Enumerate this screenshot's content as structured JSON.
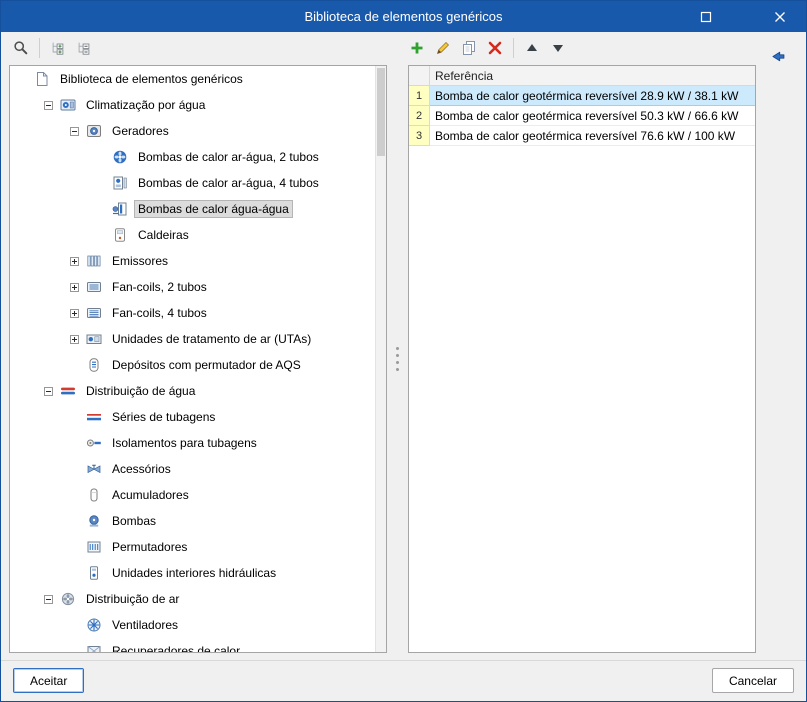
{
  "window": {
    "title": "Biblioteca de elementos genéricos",
    "buttons": [
      {
        "name": "maximize",
        "icon": "maximize"
      },
      {
        "name": "close",
        "icon": "close"
      }
    ]
  },
  "toolbar": {
    "left_buttons": [
      {
        "name": "search",
        "icon": "search"
      },
      {
        "name": "separator"
      },
      {
        "name": "expand-all",
        "icon": "tree-expand"
      },
      {
        "name": "collapse-all",
        "icon": "tree-collapse"
      }
    ],
    "right_buttons": [
      {
        "name": "add",
        "icon": "plus"
      },
      {
        "name": "edit",
        "icon": "pencil"
      },
      {
        "name": "copy",
        "icon": "copy"
      },
      {
        "name": "delete",
        "icon": "cross"
      },
      {
        "name": "separator"
      },
      {
        "name": "move-up",
        "icon": "arrow-up"
      },
      {
        "name": "move-down",
        "icon": "arrow-down"
      }
    ],
    "nav_button": {
      "name": "back",
      "icon": "back-arrow"
    }
  },
  "tree": {
    "items": [
      {
        "label": "Biblioteca de elementos genéricos",
        "level": 0,
        "icon": "library-document",
        "expander": "none",
        "selected": false
      },
      {
        "label": "Climatização por água",
        "level": 1,
        "icon": "water-climate-unit",
        "expander": "minus",
        "selected": false
      },
      {
        "label": "Geradores",
        "level": 2,
        "icon": "generator-unit",
        "expander": "minus",
        "selected": false
      },
      {
        "label": "Bombas de calor ar-água, 2 tubos",
        "level": 3,
        "icon": "heat-pump-fan",
        "expander": "none",
        "selected": false
      },
      {
        "label": "Bombas de calor ar-água, 4 tubos",
        "level": 3,
        "icon": "heat-pump-unit",
        "expander": "none",
        "selected": false
      },
      {
        "label": "Bombas de calor água-água",
        "level": 3,
        "icon": "water-water-pump",
        "expander": "none",
        "selected": true
      },
      {
        "label": "Caldeiras",
        "level": 3,
        "icon": "boiler",
        "expander": "none",
        "selected": false
      },
      {
        "label": "Emissores",
        "level": 2,
        "icon": "radiator",
        "expander": "plus",
        "selected": false
      },
      {
        "label": "Fan-coils, 2 tubos",
        "level": 2,
        "icon": "fancoil-2",
        "expander": "plus",
        "selected": false
      },
      {
        "label": "Fan-coils, 4 tubos",
        "level": 2,
        "icon": "fancoil-4",
        "expander": "plus",
        "selected": false
      },
      {
        "label": "Unidades de tratamento de ar (UTAs)",
        "level": 2,
        "icon": "ahu",
        "expander": "plus",
        "selected": false
      },
      {
        "label": "Depósitos com permutador de AQS",
        "level": 2,
        "icon": "tank-coil",
        "expander": "none",
        "selected": false
      },
      {
        "label": "Distribuição de água",
        "level": 1,
        "icon": "pipes",
        "expander": "minus",
        "selected": false
      },
      {
        "label": "Séries de tubagens",
        "level": 2,
        "icon": "pipe-lines",
        "expander": "none",
        "selected": false
      },
      {
        "label": "Isolamentos para tubagens",
        "level": 2,
        "icon": "insulation",
        "expander": "none",
        "selected": false
      },
      {
        "label": "Acessórios",
        "level": 2,
        "icon": "valve",
        "expander": "none",
        "selected": false
      },
      {
        "label": "Acumuladores",
        "level": 2,
        "icon": "cylinder",
        "expander": "none",
        "selected": false
      },
      {
        "label": "Bombas",
        "level": 2,
        "icon": "pump",
        "expander": "none",
        "selected": false
      },
      {
        "label": "Permutadores",
        "level": 2,
        "icon": "exchanger",
        "expander": "none",
        "selected": false
      },
      {
        "label": "Unidades interiores hidráulicas",
        "level": 2,
        "icon": "hydro-unit",
        "expander": "none",
        "selected": false
      },
      {
        "label": "Distribuição de ar",
        "level": 1,
        "icon": "air-unit",
        "expander": "minus",
        "selected": false
      },
      {
        "label": "Ventiladores",
        "level": 2,
        "icon": "fan-blue",
        "expander": "none",
        "selected": false
      },
      {
        "label": "Recuperadores de calor",
        "level": 2,
        "icon": "recuperator",
        "expander": "none",
        "selected": false
      }
    ]
  },
  "table": {
    "header": "Referência",
    "rows": [
      {
        "num": "1",
        "label": "Bomba de calor geotérmica reversível 28.9 kW / 38.1 kW",
        "selected": true
      },
      {
        "num": "2",
        "label": "Bomba de calor geotérmica reversível 50.3 kW / 66.6 kW",
        "selected": false
      },
      {
        "num": "3",
        "label": "Bomba de calor geotérmica reversível 76.6 kW / 100 kW",
        "selected": false
      }
    ]
  },
  "footer": {
    "accept_label": "Aceitar",
    "cancel_label": "Cancelar"
  },
  "colors": {
    "titlebar": "#1959ac",
    "selection_blue": "#cde9fc",
    "row_number_yellow": "#ffffc2",
    "tree_selection_gray": "#dcdcdc",
    "accent_blue": "#2e6fc2"
  }
}
